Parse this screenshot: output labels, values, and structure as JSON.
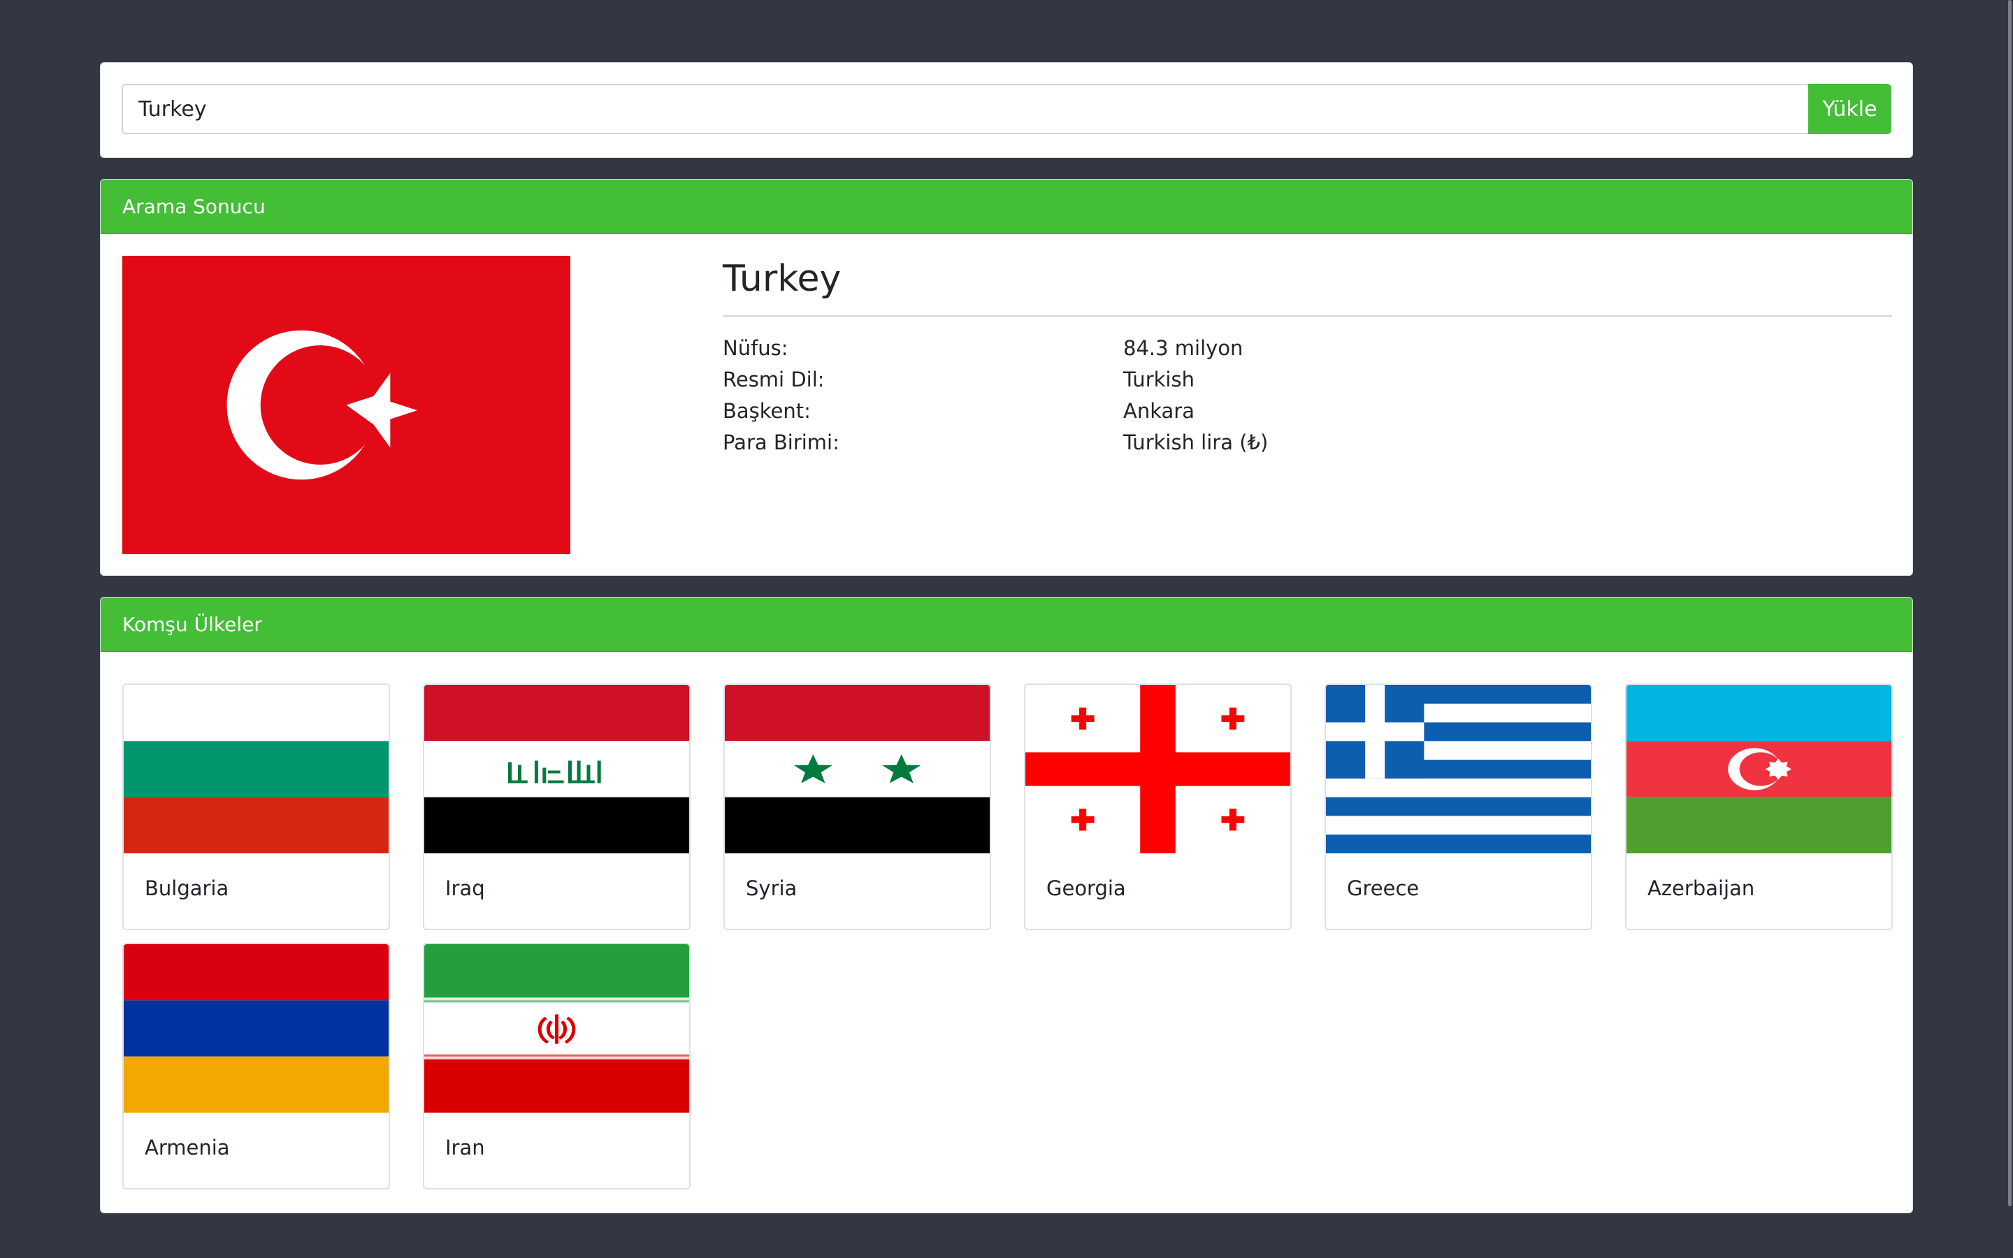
{
  "search": {
    "value": "Turkey",
    "button_label": "Yükle"
  },
  "result": {
    "header": "Arama Sonucu",
    "country_name": "Turkey",
    "rows": [
      {
        "label": "Nüfus:",
        "value": "84.3 milyon"
      },
      {
        "label": "Resmi Dil:",
        "value": "Turkish"
      },
      {
        "label": "Başkent:",
        "value": "Ankara"
      },
      {
        "label": "Para Birimi:",
        "value": "Turkish lira (₺)"
      }
    ]
  },
  "neighbors": {
    "header": "Komşu Ülkeler",
    "items": [
      {
        "name": "Bulgaria"
      },
      {
        "name": "Iraq"
      },
      {
        "name": "Syria"
      },
      {
        "name": "Georgia"
      },
      {
        "name": "Greece"
      },
      {
        "name": "Azerbaijan"
      },
      {
        "name": "Armenia"
      },
      {
        "name": "Iran"
      }
    ]
  },
  "colors": {
    "background": "#323742",
    "accent": "#44bd37",
    "turkey_red": "#e30a17"
  }
}
